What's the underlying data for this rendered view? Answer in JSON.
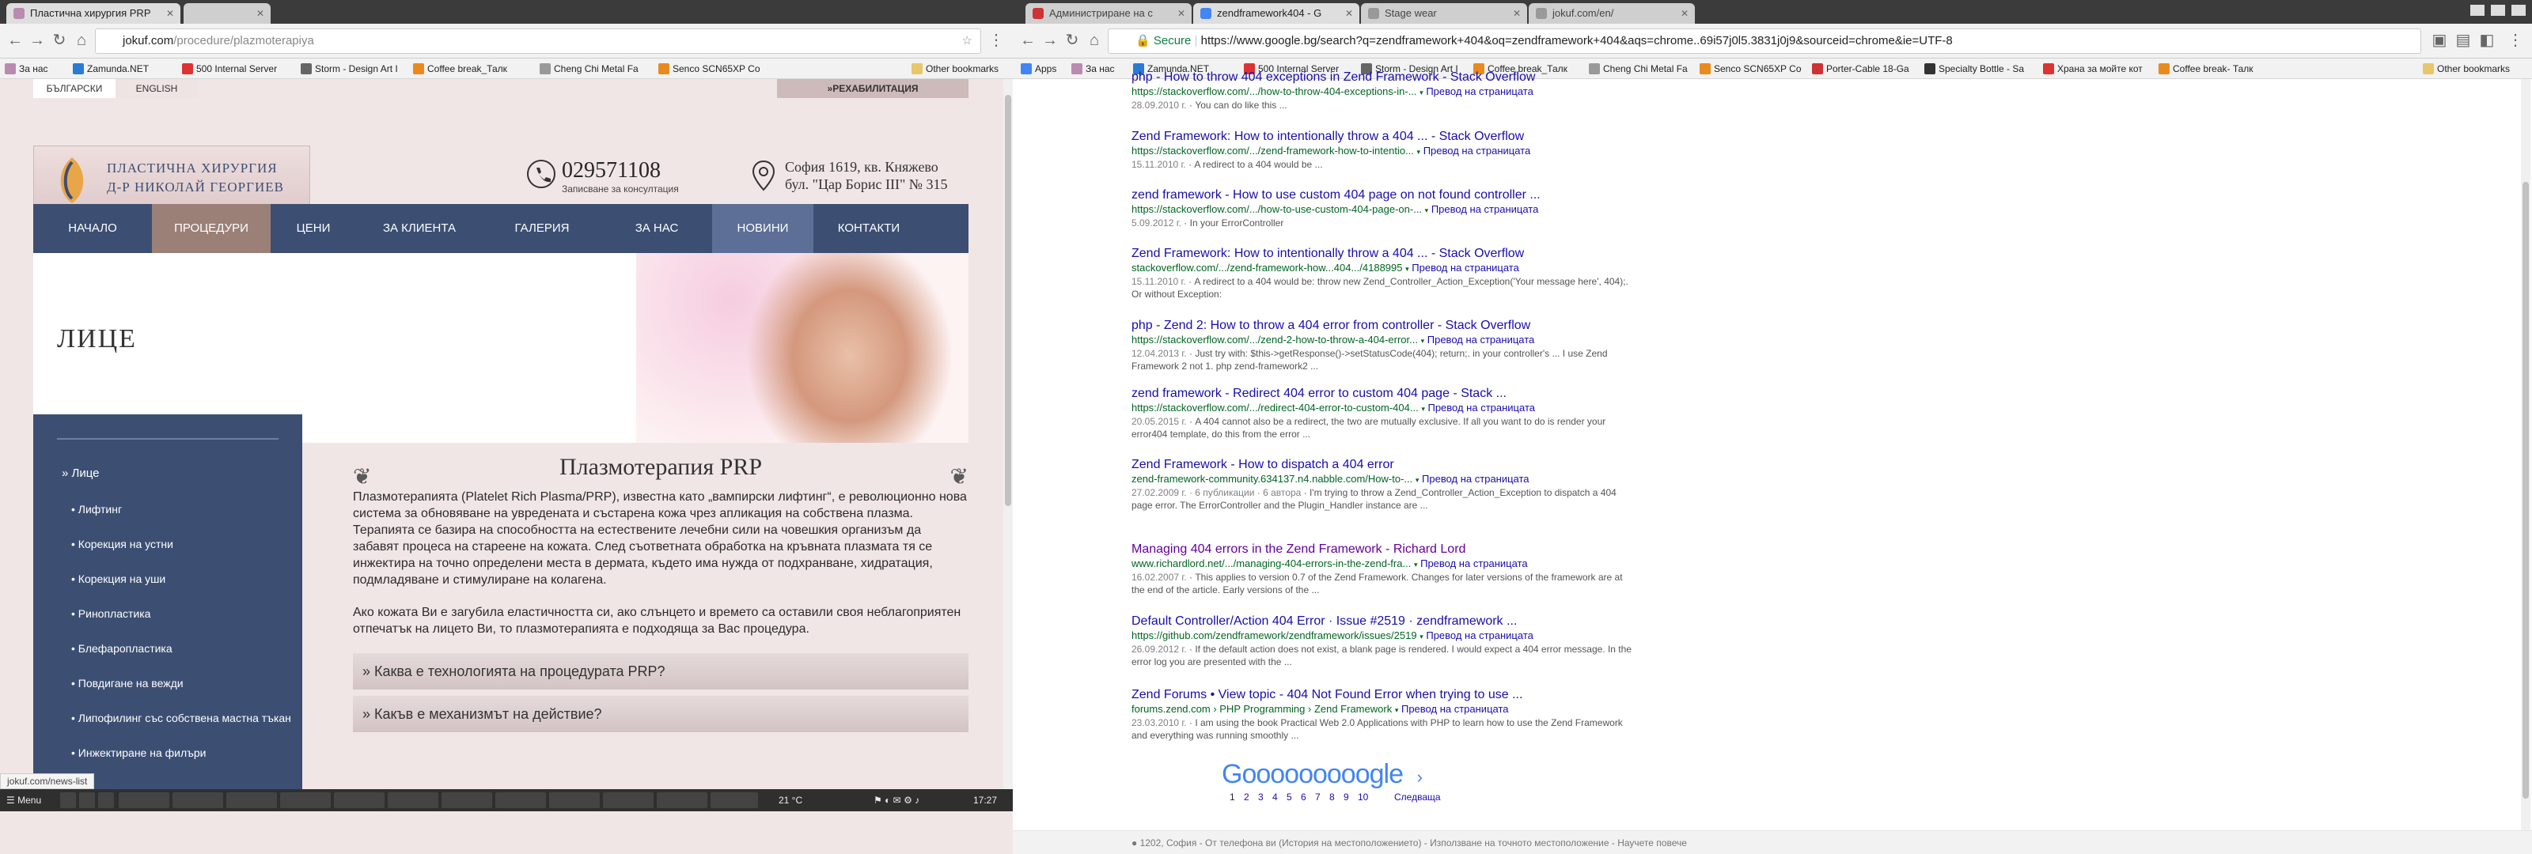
{
  "left": {
    "tabs": [
      {
        "title": "Пластична хирургия PRP"
      },
      {
        "title": ""
      }
    ],
    "address": {
      "host": "jokuf.com",
      "path": "/procedure/plazmoterapiya"
    },
    "bookmarks": [
      "За нас",
      "Zamunda.NET",
      "500 Internal Server",
      "Storm - Design Art I",
      "Coffee break_Талк",
      "Cheng Chi Metal Fa",
      "Senco SCN65XP Co",
      "Other bookmarks"
    ],
    "site": {
      "lang_bg": "БЪЛГАРСКИ",
      "lang_en": "ENGLISH",
      "rehab": "»РЕХАБИЛИТАЦИЯ",
      "logo_line1": "ПЛАСТИЧНА ХИРУРГИЯ",
      "logo_line2": "Д-Р НИКОЛАЙ ГЕОРГИЕВ",
      "phone": "029571108",
      "phone_note": "Записване за консултация",
      "address_line1": "София 1619, кв. Княжево",
      "address_line2": "бул. \"Цар Борис III\" № 315",
      "menu": [
        "НАЧАЛО",
        "ПРОЦЕДУРИ",
        "ЦЕНИ",
        "ЗА КЛИЕНТА",
        "ГАЛЕРИЯ",
        "ЗА НАС",
        "НОВИНИ",
        "КОНТАКТИ"
      ],
      "banner_title": "ЛИЦЕ",
      "side": [
        "» Лице",
        "• Лифтинг",
        "• Корекция на устни",
        "• Корекция на уши",
        "• Ринопластика",
        "• Блефаропластика",
        "• Повдигане на вежди",
        "• Липофилинг със собствена мастна тъкан",
        "• Инжектиране на филъри"
      ],
      "page_title": "Плазмотерапия PRP",
      "p1": "Плазмотерапията (Platelet Rich Plasma/PRP), известна като „вампирски лифтинг“, е революционно нова система за обновяване на увредената и състарена кожа чрез апликация на собствена плазма. Терапията се базира на способността на естествените лечебни сили на човешкия организъм да забавят процеса на стареене на кожата. След съответната обработка на кръвната плазмата тя се инжектира на точно определени места в дермата, където има нужда от подхранване, хидратация, подмладяване и стимулиране на колагена.",
      "p2": "Ако кожата Ви е загубила еластичността си, ако слънцето и времето са оставили своя неблагоприятен отпечатък на лицето Ви, то плазмотерапията е подходяща за Вас процедура.",
      "acc1": "» Каква е технологията на процедурата PRP?",
      "acc2": "» Какъв е механизмът на действие?"
    },
    "status_url": "jokuf.com/news-list",
    "taskbar": {
      "menu": "Menu",
      "weather": "21 °C",
      "clock": "17:27"
    }
  },
  "right": {
    "tabs": [
      "Администриране на с",
      "zendframework404 - G",
      "Stage wear",
      "jokuf.com/en/"
    ],
    "address": {
      "secure": "Secure",
      "url": "https://www.google.bg/search?q=zendframework+404&oq=zendframework+404&aqs=chrome..69i57j0l5.3831j0j9&sourceid=chrome&ie=UTF-8"
    },
    "bookmarks": [
      "Apps",
      "За нас",
      "Zamunda.NET",
      "500 Internal Server",
      "Storm - Design Art I",
      "Coffee break_Талк",
      "Cheng Chi Metal Fa",
      "Senco SCN65XP Co",
      "Porter-Cable 18-Ga",
      "Specialty Bottle - Sa",
      "Храна за мойте кот",
      "Coffee break- Талк",
      "Other bookmarks"
    ],
    "translate": "Превод на страницата",
    "results": [
      {
        "title": "php - How to throw 404 exceptions in Zend Framework - Stack Overflow",
        "url": "https://stackoverflow.com/.../how-to-throw-404-exceptions-in-...",
        "date": "28.09.2010 г.",
        "snippet": "You can do like this ...",
        "visited": false
      },
      {
        "title": "Zend Framework: How to intentionally throw a 404 ... - Stack Overflow",
        "url": "https://stackoverflow.com/.../zend-framework-how-to-intentio...",
        "date": "15.11.2010 г.",
        "snippet": "A redirect to a 404 would be ...",
        "visited": false
      },
      {
        "title": "zend framework - How to use custom 404 page on not found controller ...",
        "url": "https://stackoverflow.com/.../how-to-use-custom-404-page-on-...",
        "date": "5.09.2012 г.",
        "snippet": "In your ErrorController",
        "visited": false
      },
      {
        "title": "Zend Framework: How to intentionally throw a 404 ... - Stack Overflow",
        "url": "stackoverflow.com/.../zend-framework-how...404.../4188995",
        "date": "15.11.2010 г.",
        "snippet": "A redirect to a 404 would be: throw new Zend_Controller_Action_Exception('Your message here', 404);. Or without Exception:",
        "visited": false
      },
      {
        "title": "php - Zend 2: How to throw a 404 error from controller - Stack Overflow",
        "url": "https://stackoverflow.com/.../zend-2-how-to-throw-a-404-error...",
        "date": "12.04.2013 г.",
        "snippet": "Just try with: $this->getResponse()->setStatusCode(404); return;. in your controller's ... I use Zend Framework 2 not 1. php zend-framework2 ...",
        "visited": false
      },
      {
        "title": "zend framework - Redirect 404 error to custom 404 page - Stack ...",
        "url": "https://stackoverflow.com/.../redirect-404-error-to-custom-404...",
        "date": "20.05.2015 г.",
        "snippet": "A 404 cannot also be a redirect, the two are mutually exclusive. If all you want to do is render your error404 template, do this from the error ...",
        "visited": false
      },
      {
        "title": "Zend Framework - How to dispatch a 404 error",
        "url": "zend-framework-community.634137.n4.nabble.com/How-to-...",
        "date": "27.02.2009 г. · 6 публикации · 6 автора",
        "snippet": "I'm trying to throw a Zend_Controller_Action_Exception to dispatch a 404 page error. The ErrorController and the Plugin_Handler instance are ...",
        "visited": false
      },
      {
        "title": "Managing 404 errors in the Zend Framework - Richard Lord",
        "url": "www.richardlord.net/.../managing-404-errors-in-the-zend-fra...",
        "date": "16.02.2007 г.",
        "snippet": "This applies to version 0.7 of the Zend Framework. Changes for later versions of the framework are at the end of the article. Early versions of the ...",
        "visited": true
      },
      {
        "title": "Default Controller/Action 404 Error · Issue #2519 · zendframework ...",
        "url": "https://github.com/zendframework/zendframework/issues/2519",
        "date": "26.09.2012 г.",
        "snippet": "If the default action does not exist, a blank page is rendered. I would expect a 404 error message. In the error log you are presented with the ...",
        "visited": false
      },
      {
        "title": "Zend Forums • View topic - 404 Not Found Error when trying to use ...",
        "url": "forums.zend.com › PHP Programming › Zend Framework",
        "date": "23.03.2010 г.",
        "snippet": "I am using the book Practical Web 2.0 Applications with PHP to learn how to use the Zend Framework and everything was running smoothly ...",
        "visited": false
      }
    ],
    "pager": {
      "logo": "Gooooooooogle",
      "pages": [
        "1",
        "2",
        "3",
        "4",
        "5",
        "6",
        "7",
        "8",
        "9",
        "10"
      ],
      "next": "Следваща"
    },
    "footer": "● 1202, София - От телефона ви (История на местоположението) - Използване на точното местоположение - Научете повече"
  },
  "colors": {
    "site_blue": "#3c4f73",
    "site_pink": "#f1e6e6",
    "link": "#1a0dab",
    "visited": "#660099",
    "url_green": "#006621"
  }
}
